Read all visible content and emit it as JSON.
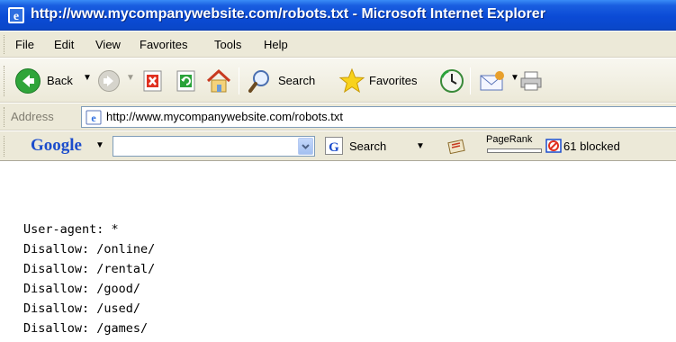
{
  "window": {
    "title": "http://www.mycompanywebsite.com/robots.txt - Microsoft Internet Explorer"
  },
  "menu": {
    "items": [
      "File",
      "Edit",
      "View",
      "Favorites",
      "Tools",
      "Help"
    ]
  },
  "toolbar": {
    "back_label": "Back",
    "search_label": "Search",
    "favorites_label": "Favorites"
  },
  "address": {
    "label": "Address",
    "url": "http://www.mycompanywebsite.com/robots.txt"
  },
  "google_toolbar": {
    "logo": "Google",
    "search_value": "",
    "search_label": "Search",
    "pagerank_label": "PageRank",
    "popups_blocked": "61 blocked"
  },
  "page_text": {
    "lines": [
      "User-agent: *",
      "Disallow: /online/",
      "Disallow: /rental/",
      "Disallow: /good/",
      "Disallow: /used/",
      "Disallow: /games/"
    ]
  },
  "colors": {
    "titlebar": "#0b4bd6",
    "chrome": "#ece9d8",
    "address_border": "#7f9db9",
    "google_blue": "#1c4dcc"
  },
  "icons": {
    "title": "ie-logo-icon",
    "back": "back-arrow-icon",
    "forward": "forward-arrow-icon",
    "stop": "stop-icon",
    "refresh": "refresh-icon",
    "home": "home-icon",
    "search": "magnifier-icon",
    "favorites": "star-icon",
    "history": "history-icon",
    "mail": "mail-icon",
    "print": "print-icon"
  }
}
